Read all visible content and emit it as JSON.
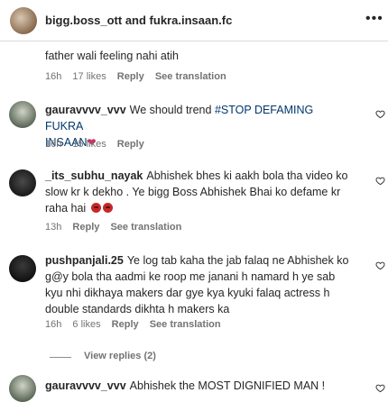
{
  "header": {
    "title": "bigg.boss_ott and fukra.insaan.fc",
    "more_icon": "more-horizontal-icon"
  },
  "comments": [
    {
      "username": "",
      "text": "father wali feeling nahi atih",
      "time": "16h",
      "likes": "17 likes",
      "reply": "Reply",
      "translation": "See translation"
    },
    {
      "username": "gauravvvv_vvv",
      "text_before": "We should trend ",
      "hashtag": "#STOP DEFAMING FUKRA",
      "text_after": "INSAAN",
      "time": "16h",
      "likes": "15 likes",
      "reply": "Reply"
    },
    {
      "username": "_its_subhu_nayak",
      "text": "Abhishek bhes ki aakh bola tha video ko slow kr k dekho . Ye bigg Boss Abhishek Bhai ko defame kr raha hai",
      "time": "13h",
      "reply": "Reply",
      "translation": "See translation"
    },
    {
      "username": "pushpanjali.25",
      "text": "Ye log tab kaha the jab falaq ne Abhishek ko g@y bola tha aadmi ke roop me janani h namard h ye sab kyu nhi dikhaya makers dar gye kya kyuki falaq actress h double standards dikhta h makers ka",
      "time": "16h",
      "likes": "6 likes",
      "reply": "Reply",
      "translation": "See translation",
      "view_replies": "View replies (2)"
    },
    {
      "username": "gauravvvv_vvv",
      "text": "Abhishek the MOST DIGNIFIED MAN !"
    }
  ],
  "colors": {
    "text": "#262626",
    "meta": "#737373",
    "hashtag": "#00376b",
    "divider": "#dbdbdb"
  }
}
